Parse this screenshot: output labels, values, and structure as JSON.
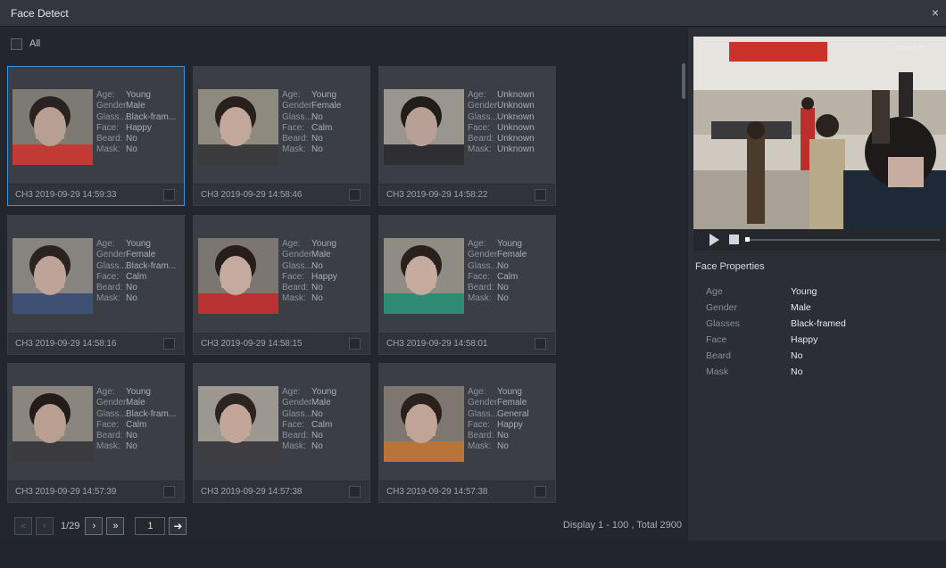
{
  "window": {
    "title": "Face Detect",
    "close_glyph": "×"
  },
  "select_all_label": "All",
  "attr_keys": {
    "age": "Age:",
    "gender": "Gender:",
    "glasses": "Glass...",
    "face": "Face:",
    "beard": "Beard:",
    "mask": "Mask:"
  },
  "cards": [
    {
      "age": "Young",
      "gender": "Male",
      "glasses": "Black-fram...",
      "face": "Happy",
      "beard": "No",
      "mask": "No",
      "timestamp": "CH3 2019-09-29 14:59:33",
      "selected": true
    },
    {
      "age": "Young",
      "gender": "Female",
      "glasses": "No",
      "face": "Calm",
      "beard": "No",
      "mask": "No",
      "timestamp": "CH3 2019-09-29 14:58:46",
      "selected": false
    },
    {
      "age": "Unknown",
      "gender": "Unknown",
      "glasses": "Unknown",
      "face": "Unknown",
      "beard": "Unknown",
      "mask": "Unknown",
      "timestamp": "CH3 2019-09-29 14:58:22",
      "selected": false
    },
    {
      "age": "Young",
      "gender": "Female",
      "glasses": "Black-fram...",
      "face": "Calm",
      "beard": "No",
      "mask": "No",
      "timestamp": "CH3 2019-09-29 14:58:16",
      "selected": false
    },
    {
      "age": "Young",
      "gender": "Male",
      "glasses": "No",
      "face": "Happy",
      "beard": "No",
      "mask": "No",
      "timestamp": "CH3 2019-09-29 14:58:15",
      "selected": false
    },
    {
      "age": "Young",
      "gender": "Female",
      "glasses": "No",
      "face": "Calm",
      "beard": "No",
      "mask": "No",
      "timestamp": "CH3 2019-09-29 14:58:01",
      "selected": false
    },
    {
      "age": "Young",
      "gender": "Male",
      "glasses": "Black-fram...",
      "face": "Calm",
      "beard": "No",
      "mask": "No",
      "timestamp": "CH3 2019-09-29 14:57:39",
      "selected": false
    },
    {
      "age": "Young",
      "gender": "Male",
      "glasses": "No",
      "face": "Calm",
      "beard": "No",
      "mask": "No",
      "timestamp": "CH3 2019-09-29 14:57:38",
      "selected": false
    },
    {
      "age": "Young",
      "gender": "Female",
      "glasses": "General",
      "face": "Happy",
      "beard": "No",
      "mask": "No",
      "timestamp": "CH3 2019-09-29 14:57:38",
      "selected": false
    }
  ],
  "pager": {
    "first_glyph": "«",
    "prev_glyph": "‹",
    "next_glyph": "›",
    "last_glyph": "»",
    "go_glyph": "➜",
    "page_info": "1/29",
    "page_input": "1",
    "display_info": "Display 1 - 100 , Total 2900"
  },
  "side_panel": {
    "video_timestamp": "2019-09-29",
    "title": "Face Properties",
    "properties": [
      {
        "key": "Age",
        "value": "Young"
      },
      {
        "key": "Gender",
        "value": "Male"
      },
      {
        "key": "Glasses",
        "value": "Black-framed"
      },
      {
        "key": "Face",
        "value": "Happy"
      },
      {
        "key": "Beard",
        "value": "No"
      },
      {
        "key": "Mask",
        "value": "No"
      }
    ]
  },
  "colors": {
    "accent": "#3d8fd6",
    "card_bg": "#3b3e45",
    "panel_bg": "#2b2e34"
  }
}
